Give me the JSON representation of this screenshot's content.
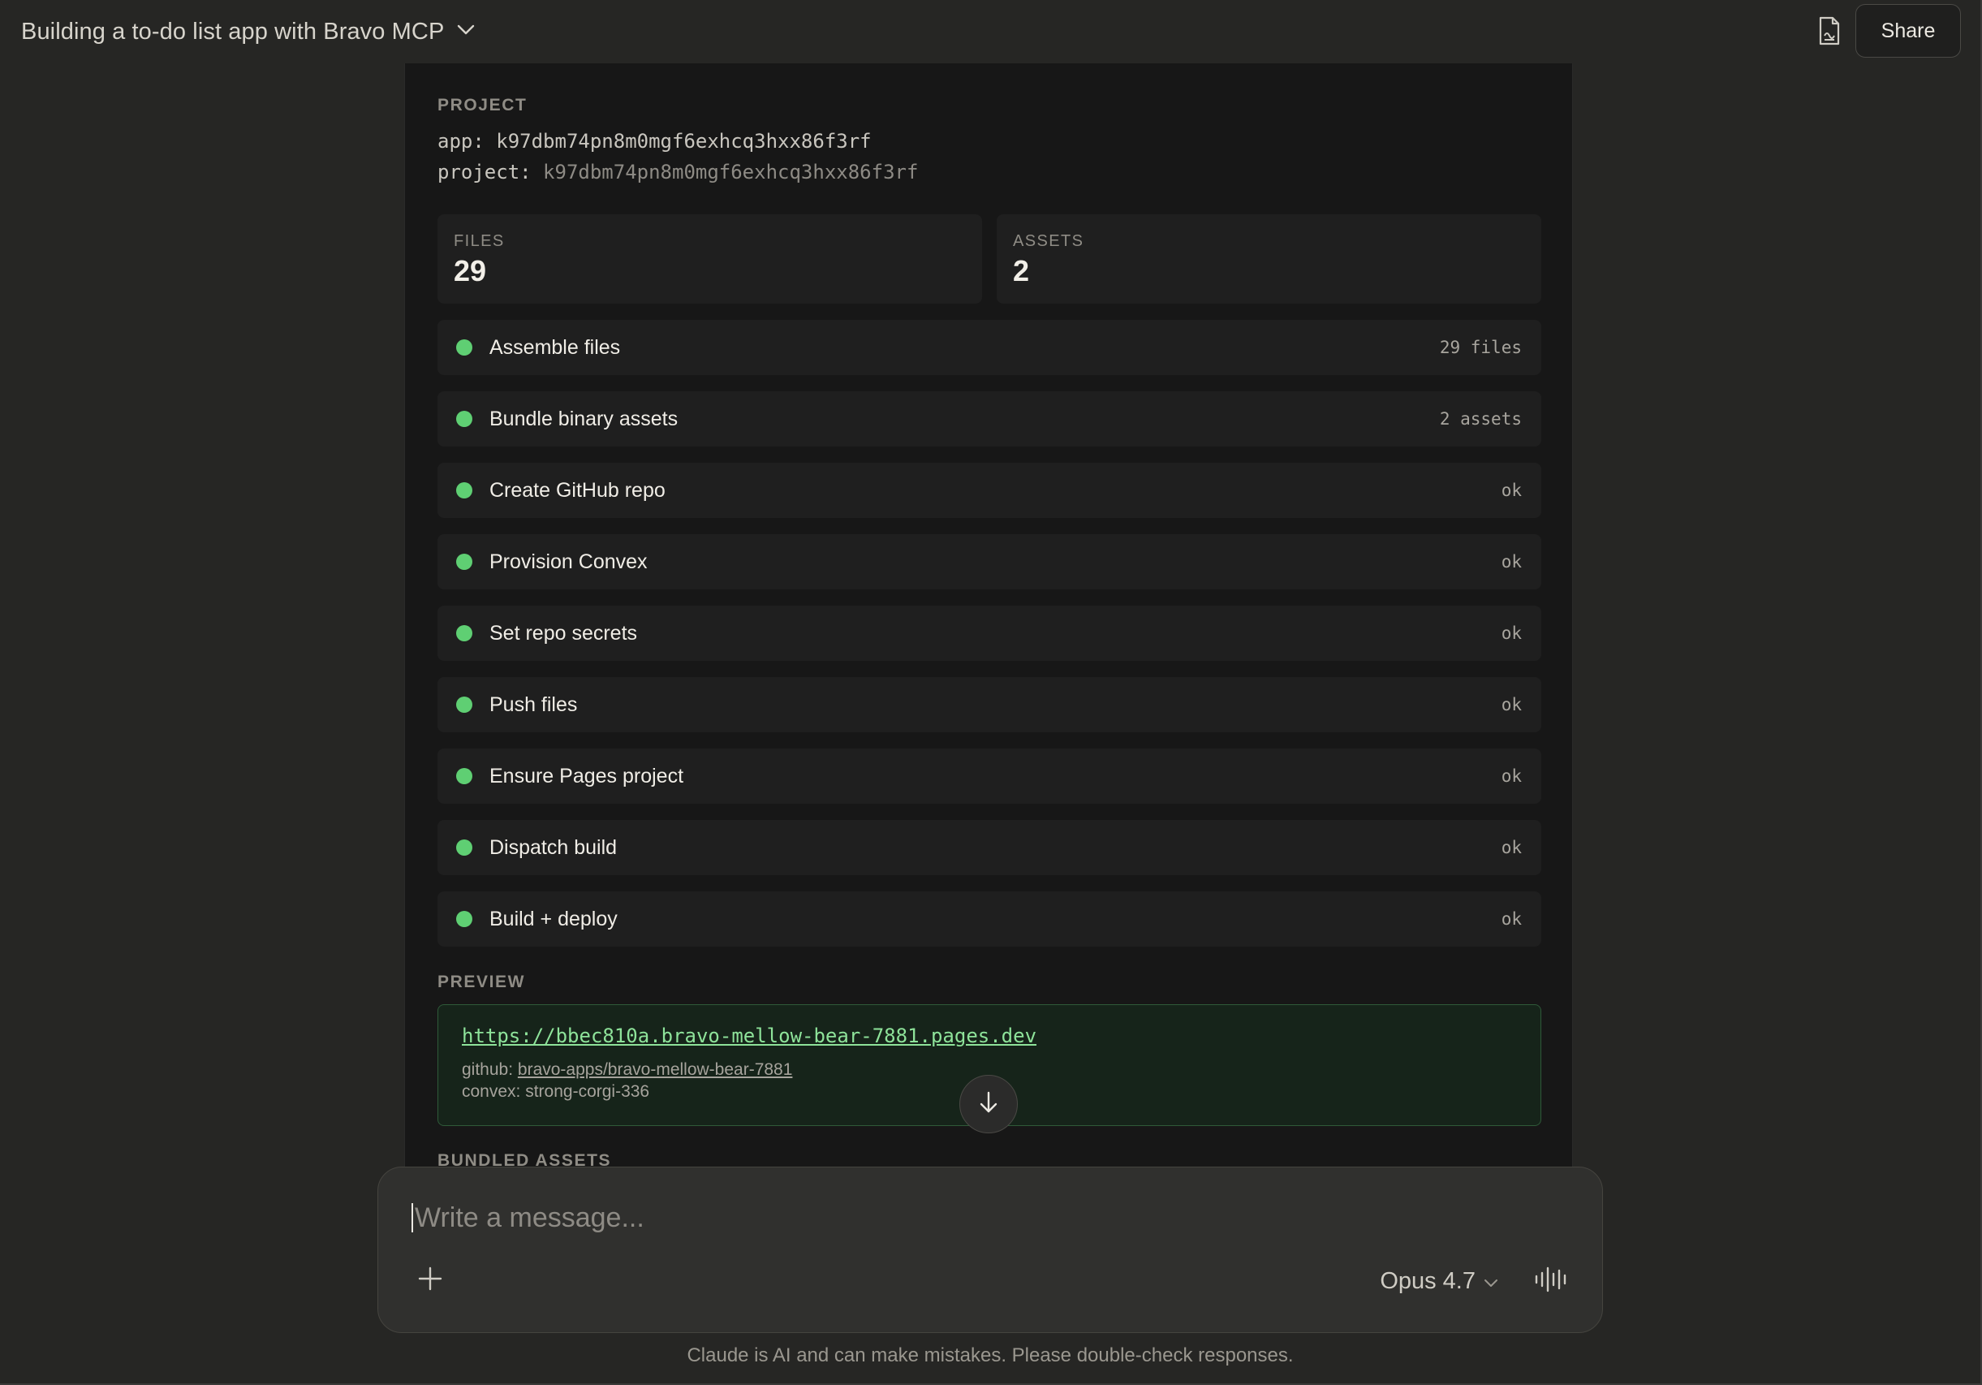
{
  "header": {
    "chat_title": "Building a to-do list app with Bravo MCP",
    "share_label": "Share"
  },
  "project": {
    "section_label": "PROJECT",
    "app_key": "app:",
    "app_value": "k97dbm74pn8m0mgf6exhcq3hxx86f3rf",
    "project_key": "project:",
    "project_value": "k97dbm74pn8m0mgf6exhcq3hxx86f3rf"
  },
  "stats": {
    "files_label": "FILES",
    "files_value": "29",
    "assets_label": "ASSETS",
    "assets_value": "2"
  },
  "steps": [
    {
      "label": "Assemble files",
      "status": "29 files",
      "state": "done"
    },
    {
      "label": "Bundle binary assets",
      "status": "2 assets",
      "state": "done"
    },
    {
      "label": "Create GitHub repo",
      "status": "ok",
      "state": "done"
    },
    {
      "label": "Provision Convex",
      "status": "ok",
      "state": "done"
    },
    {
      "label": "Set repo secrets",
      "status": "ok",
      "state": "done"
    },
    {
      "label": "Push files",
      "status": "ok",
      "state": "done"
    },
    {
      "label": "Ensure Pages project",
      "status": "ok",
      "state": "done"
    },
    {
      "label": "Dispatch build",
      "status": "ok",
      "state": "done"
    },
    {
      "label": "Build + deploy",
      "status": "ok",
      "state": "done"
    }
  ],
  "preview": {
    "section_label": "PREVIEW",
    "url": "https://bbec810a.bravo-mellow-bear-7881.pages.dev",
    "github_key": "github:",
    "github_value": "bravo-apps/bravo-mellow-bear-7881",
    "convex_line": "convex: strong-corgi-336"
  },
  "bundled_assets_label": "BUNDLED ASSETS",
  "composer": {
    "placeholder": "Write a message...",
    "model_label": "Opus 4.7"
  },
  "disclaimer": "Claude is AI and can make mistakes. Please double-check responses.",
  "colors": {
    "status_ok": "#5fcf73",
    "link_green": "#8ee39a",
    "background": "#262624",
    "card": "#171717"
  },
  "icons": {
    "title_dropdown": "chevron-down-icon",
    "artifact": "document-icon",
    "scroll": "arrow-down-icon",
    "add": "plus-icon",
    "model_dropdown": "chevron-down-icon",
    "voice": "waveform-icon"
  }
}
